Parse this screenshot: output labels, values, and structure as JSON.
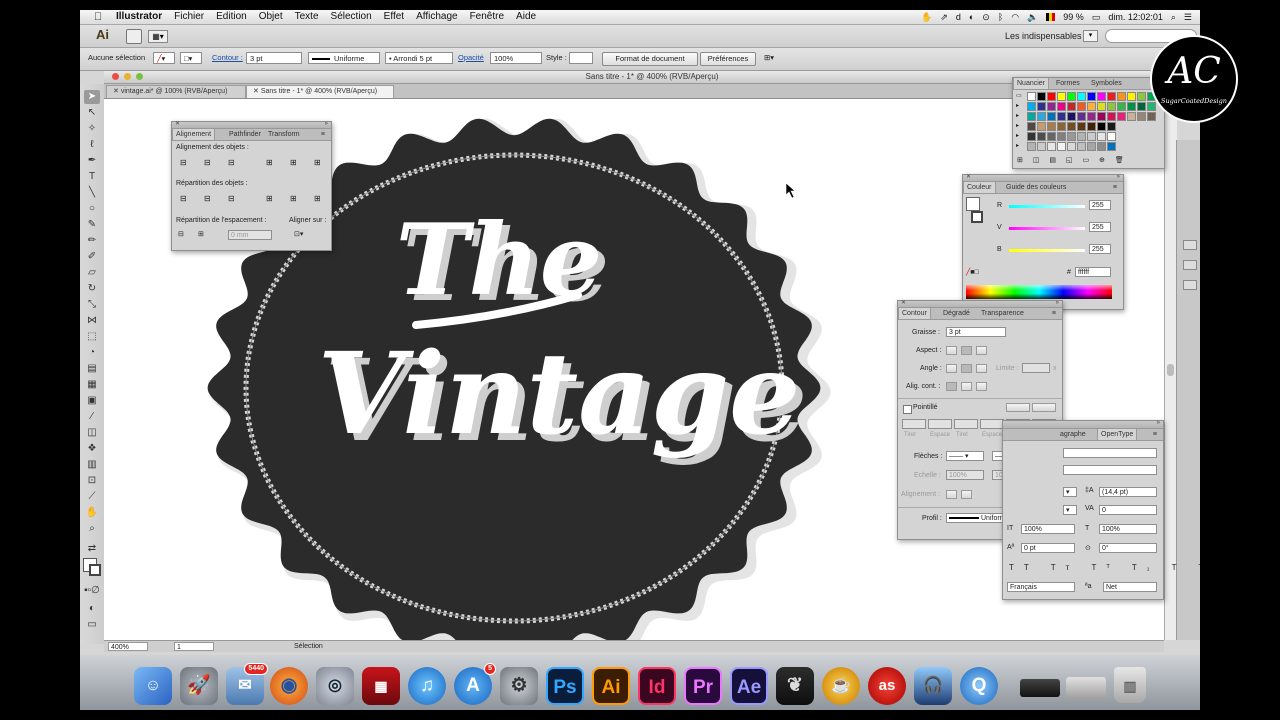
{
  "menubar": {
    "items": [
      "Illustrator",
      "Fichier",
      "Edition",
      "Objet",
      "Texte",
      "Sélection",
      "Effet",
      "Affichage",
      "Fenêtre",
      "Aide"
    ],
    "battery": "99 %",
    "clock": "dim. 12:02:01"
  },
  "appbar": {
    "logo": "Ai",
    "workspace": "Les indispensables"
  },
  "control": {
    "selection_label": "Aucune sélection",
    "stroke_label": "Contour :",
    "stroke_weight": "3 pt",
    "profile": "Uniforme",
    "brush": "Arrondi 5 pt",
    "opacity_label": "Opacité",
    "opacity": "100%",
    "style_label": "Style :",
    "doc_setup": "Format de document",
    "prefs": "Préférences"
  },
  "window": {
    "title": "Sans titre - 1* @ 400% (RVB/Aperçu)",
    "tabs": [
      "vintage.ai* @ 100% (RVB/Aperçu)",
      "Sans titre - 1* @ 400% (RVB/Aperçu)"
    ]
  },
  "artwork": {
    "line1": "The",
    "line2": "Vintage"
  },
  "status": {
    "zoom": "400%",
    "page": "1",
    "mode": "Sélection"
  },
  "align_panel": {
    "tabs": [
      "Alignement",
      "Pathfinder",
      "Transform"
    ],
    "align_objects": "Alignement des objets :",
    "distribute_objects": "Répartition des objets :",
    "distribute_spacing": "Répartition de l'espacement :",
    "align_to": "Aligner sur :",
    "spacing_value": "0 mm"
  },
  "swatches_panel": {
    "tabs": [
      "Nuancier",
      "Formes",
      "Symboles"
    ]
  },
  "color_panel": {
    "tabs": [
      "Couleur",
      "Guide des couleurs"
    ],
    "r_label": "R",
    "r": "255",
    "g_label": "V",
    "g": "255",
    "b_label": "B",
    "b": "255",
    "hex_label": "#",
    "hex": "ffffff"
  },
  "stroke_panel": {
    "tabs": [
      "Contour",
      "Dégradé",
      "Transparence"
    ],
    "weight_label": "Graisse :",
    "weight": "3 pt",
    "cap_label": "Aspect :",
    "corner_label": "Angle :",
    "limit_label": "Limite :",
    "limit_x": "x",
    "align_label": "Alig. cont. :",
    "dashed_label": "Pointillé",
    "dash_labels": [
      "Tiret",
      "Espace",
      "Tiret",
      "Espace",
      "Tiret",
      "Espace"
    ],
    "arrows_label": "Flèches :",
    "scale_label": "Echelle :",
    "scale1": "100%",
    "scale2": "100%",
    "alignment_label": "Alignement :",
    "profile_label": "Profil :",
    "profile": "Uniforme"
  },
  "char_panel": {
    "tabs": [
      "agraphe",
      "OpenType"
    ],
    "leading": "(14,4 pt)",
    "tracking": "0",
    "hscale": "100%",
    "vscale": "100%",
    "baseline": "0 pt",
    "rotation": "0°",
    "language": "Français",
    "aa": "Net"
  },
  "watermark": {
    "initials": "AC",
    "name": "SugarCoatedDesign"
  },
  "dock": {
    "mail_badge": "5440",
    "appstore_badge": "5",
    "apps": [
      "Ps",
      "Ai",
      "Id",
      "Pr",
      "Ae"
    ]
  },
  "colors": {
    "badge_dark": "#2b2b2b",
    "ps": "#0a1d3a",
    "ai": "#3a1d02",
    "id": "#3a0620",
    "pr": "#2a0a3d",
    "ae": "#14103a"
  }
}
